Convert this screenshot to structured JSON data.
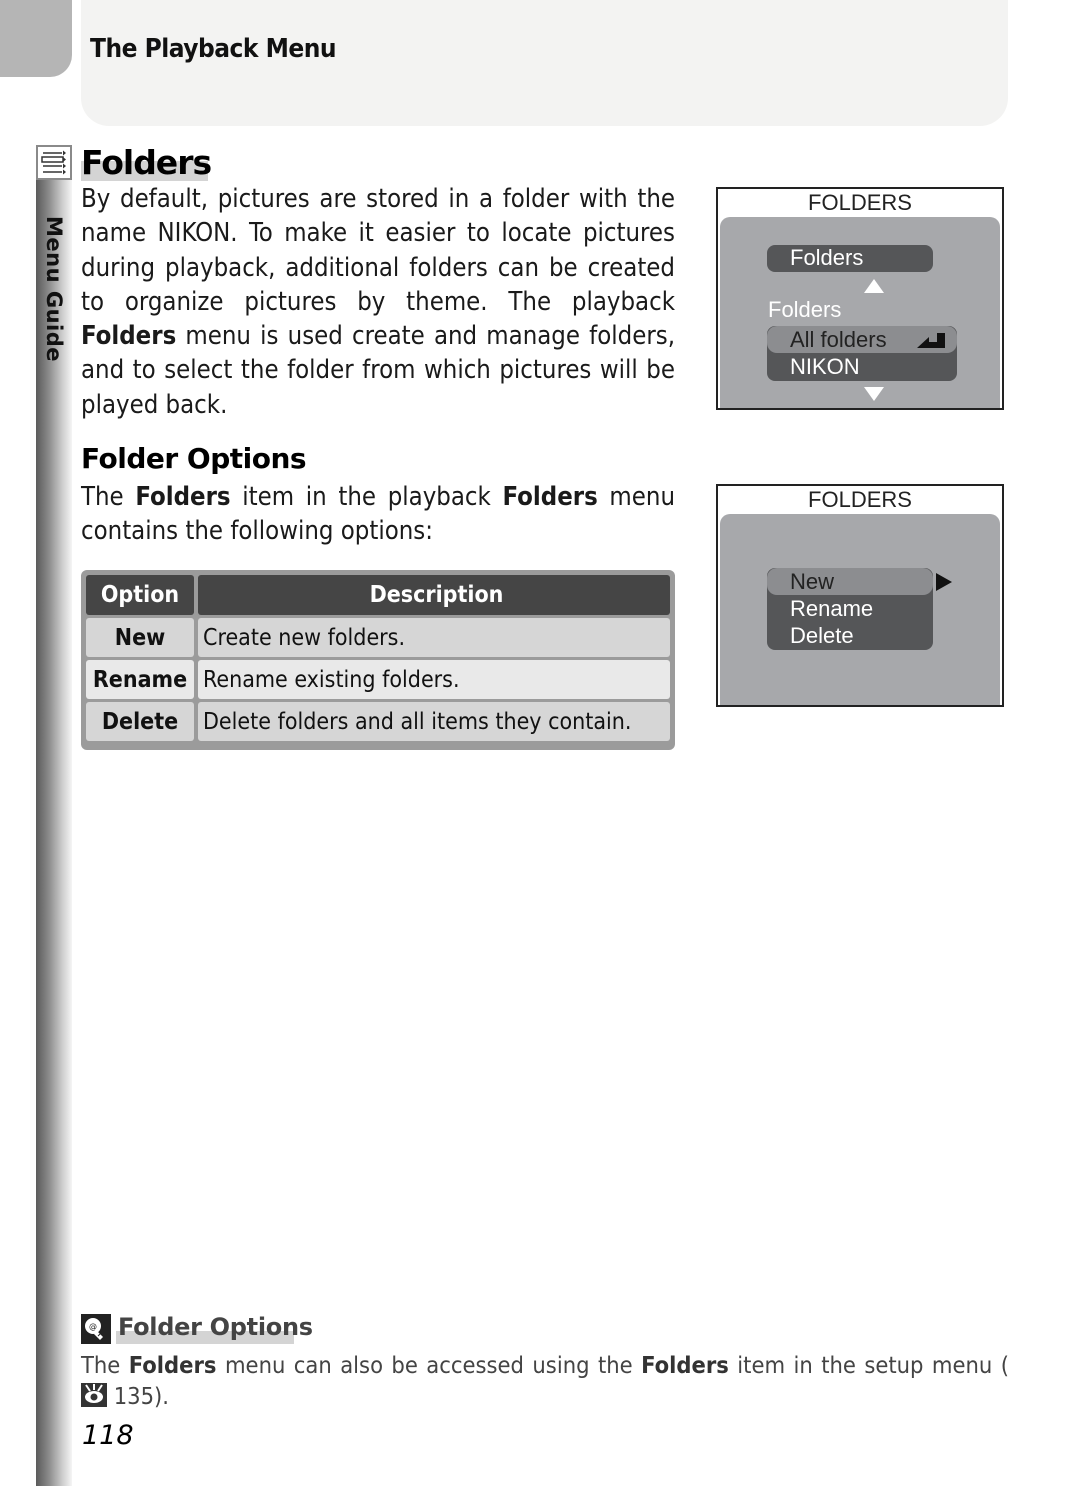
{
  "header": {
    "title": "The Playback Menu"
  },
  "side_tab": {
    "label": "Menu Guide"
  },
  "section": {
    "title": "Folders",
    "intro": {
      "before_bold": "By default, pictures are stored in a folder with the name NIKON.  To make it easier to locate pictures during playback, additional folders can be created to organize pictures by theme.  The playback ",
      "bold": "Folders",
      "after_bold": " menu is used create and manage folders, and to select the folder from which pictures will be played back."
    }
  },
  "folder_options": {
    "heading": "Folder Options",
    "intro": {
      "part1": "The ",
      "bold1": "Folders",
      "part2": " item in the playback ",
      "bold2": "Folders",
      "part3": " menu contains the following options:"
    },
    "table": {
      "headers": [
        "Option",
        "Description"
      ],
      "rows": [
        {
          "option": "New",
          "description": "Create new folders."
        },
        {
          "option": "Rename",
          "description": "Rename existing folders."
        },
        {
          "option": "Delete",
          "description": "Delete folders and all items they contain."
        }
      ]
    }
  },
  "screen1": {
    "title": "FOLDERS",
    "selected_item": "Folders",
    "sub_label": "Folders",
    "options": [
      "All folders",
      "NIKON"
    ],
    "highlighted_option": "All folders"
  },
  "screen2": {
    "title": "FOLDERS",
    "options": [
      "New",
      "Rename",
      "Delete"
    ],
    "highlighted_option": "New"
  },
  "tip": {
    "icon": "lightbulb-icon",
    "title": "Folder Options",
    "text": {
      "part1": "The ",
      "bold1": "Folders",
      "part2": " menu can also be accessed using the ",
      "bold2": "Folders",
      "part3": " item in the setup menu (",
      "ref_icon": "setup-menu-icon",
      "ref_page": " 135)."
    }
  },
  "page_number": "118"
}
